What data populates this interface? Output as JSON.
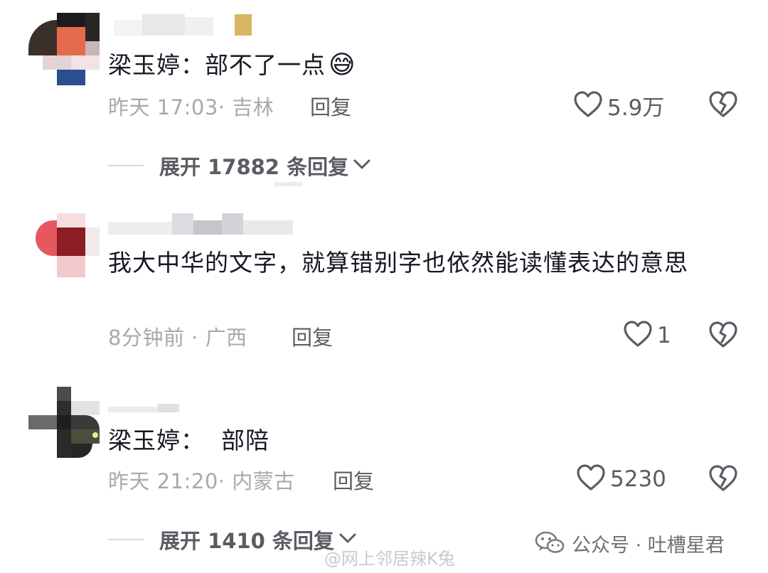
{
  "comments": [
    {
      "text": "梁玉婷：部不了一点",
      "emoji": "😅",
      "meta": "昨天 17:03· 吉林",
      "reply_label": "回复",
      "likes": "5.9万",
      "expand_label": "展开 17882 条回复"
    },
    {
      "text": "我大中华的文字，就算错别字也依然能读懂表达的意思",
      "meta": "8分钟前 · 广西",
      "reply_label": "回复",
      "likes": "1"
    },
    {
      "text": "梁玉婷：  部陪",
      "meta": "昨天 21:20· 内蒙古",
      "reply_label": "回复",
      "likes": "5230",
      "expand_label": "展开 1410 条回复"
    }
  ],
  "watermark": {
    "text": "公众号 · 吐槽星君",
    "weibo": "@网上邻居辣K兔"
  }
}
